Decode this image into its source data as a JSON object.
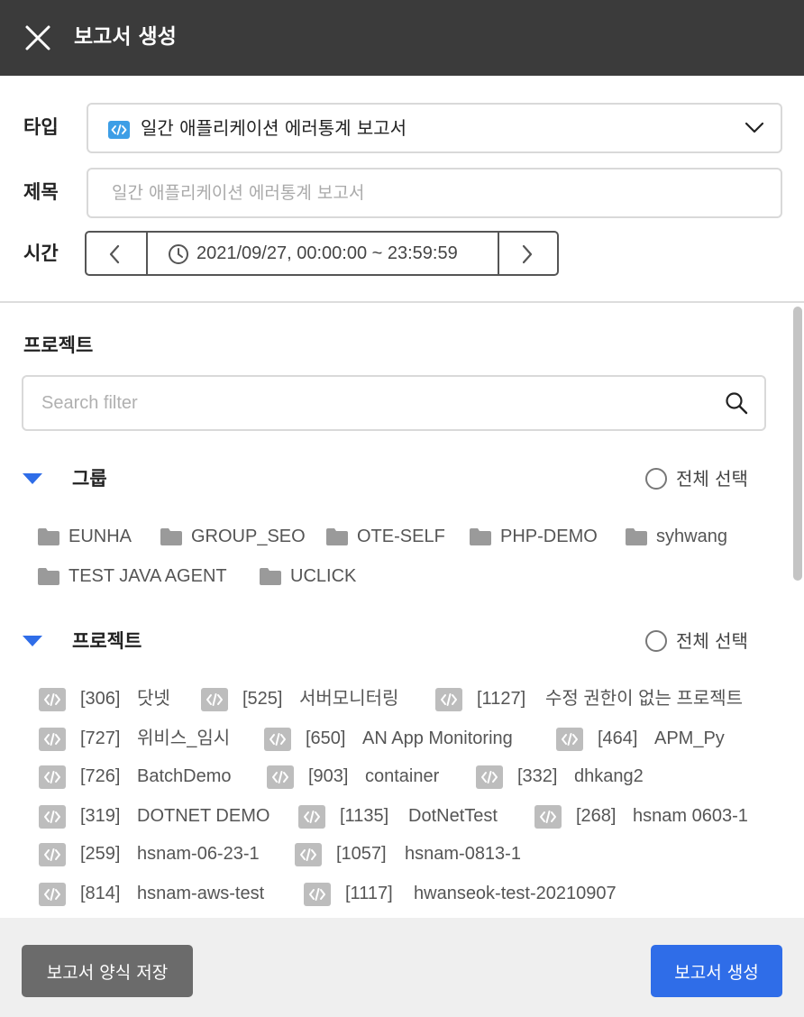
{
  "header": {
    "title": "보고서 생성",
    "close_icon": "close-icon"
  },
  "form": {
    "type_label": "타입",
    "type_value": "일간 애플리케이션 에러통계 보고서",
    "title_label": "제목",
    "title_placeholder": "일간 애플리케이션 에러통계 보고서",
    "title_value": "",
    "time_label": "시간",
    "time_range": "2021/09/27, 00:00:00 ~ 23:59:59"
  },
  "projects_section": {
    "title": "프로젝트",
    "search_placeholder": "Search filter",
    "groups": {
      "header": "그룹",
      "select_all": "전체 선택",
      "items": [
        "EUNHA",
        "GROUP_SEO",
        "OTE-SELF",
        "PHP-DEMO",
        "syhwang",
        "TEST JAVA AGENT",
        "UCLICK"
      ]
    },
    "projects": {
      "header": "프로젝트",
      "select_all": "전체 선택",
      "items": [
        {
          "id": "[306]",
          "name": "닷넷"
        },
        {
          "id": "[525]",
          "name": "서버모니터링"
        },
        {
          "id": "[1127]",
          "name": "수정 권한이 없는 프로젝트"
        },
        {
          "id": "[727]",
          "name": "위비스_임시"
        },
        {
          "id": "[650]",
          "name": "AN App Monitoring"
        },
        {
          "id": "[464]",
          "name": "APM_Py"
        },
        {
          "id": "[726]",
          "name": "BatchDemo"
        },
        {
          "id": "[903]",
          "name": "container"
        },
        {
          "id": "[332]",
          "name": "dhkang2"
        },
        {
          "id": "[319]",
          "name": "DOTNET DEMO"
        },
        {
          "id": "[1135]",
          "name": "DotNetTest"
        },
        {
          "id": "[268]",
          "name": "hsnam 0603-1"
        },
        {
          "id": "[259]",
          "name": "hsnam-06-23-1"
        },
        {
          "id": "[1057]",
          "name": "hsnam-0813-1"
        },
        {
          "id": "[814]",
          "name": "hsnam-aws-test"
        },
        {
          "id": "[1117]",
          "name": "hwanseok-test-20210907"
        }
      ]
    }
  },
  "footer": {
    "save_template_label": "보고서 양식 저장",
    "create_label": "보고서 생성"
  },
  "colors": {
    "header_bg": "#3b3b3b",
    "primary_button": "#2f6de8",
    "secondary_button": "#6b6b6b",
    "collapse_triangle": "#2f6de8",
    "app_icon": "#3d9ee6"
  }
}
